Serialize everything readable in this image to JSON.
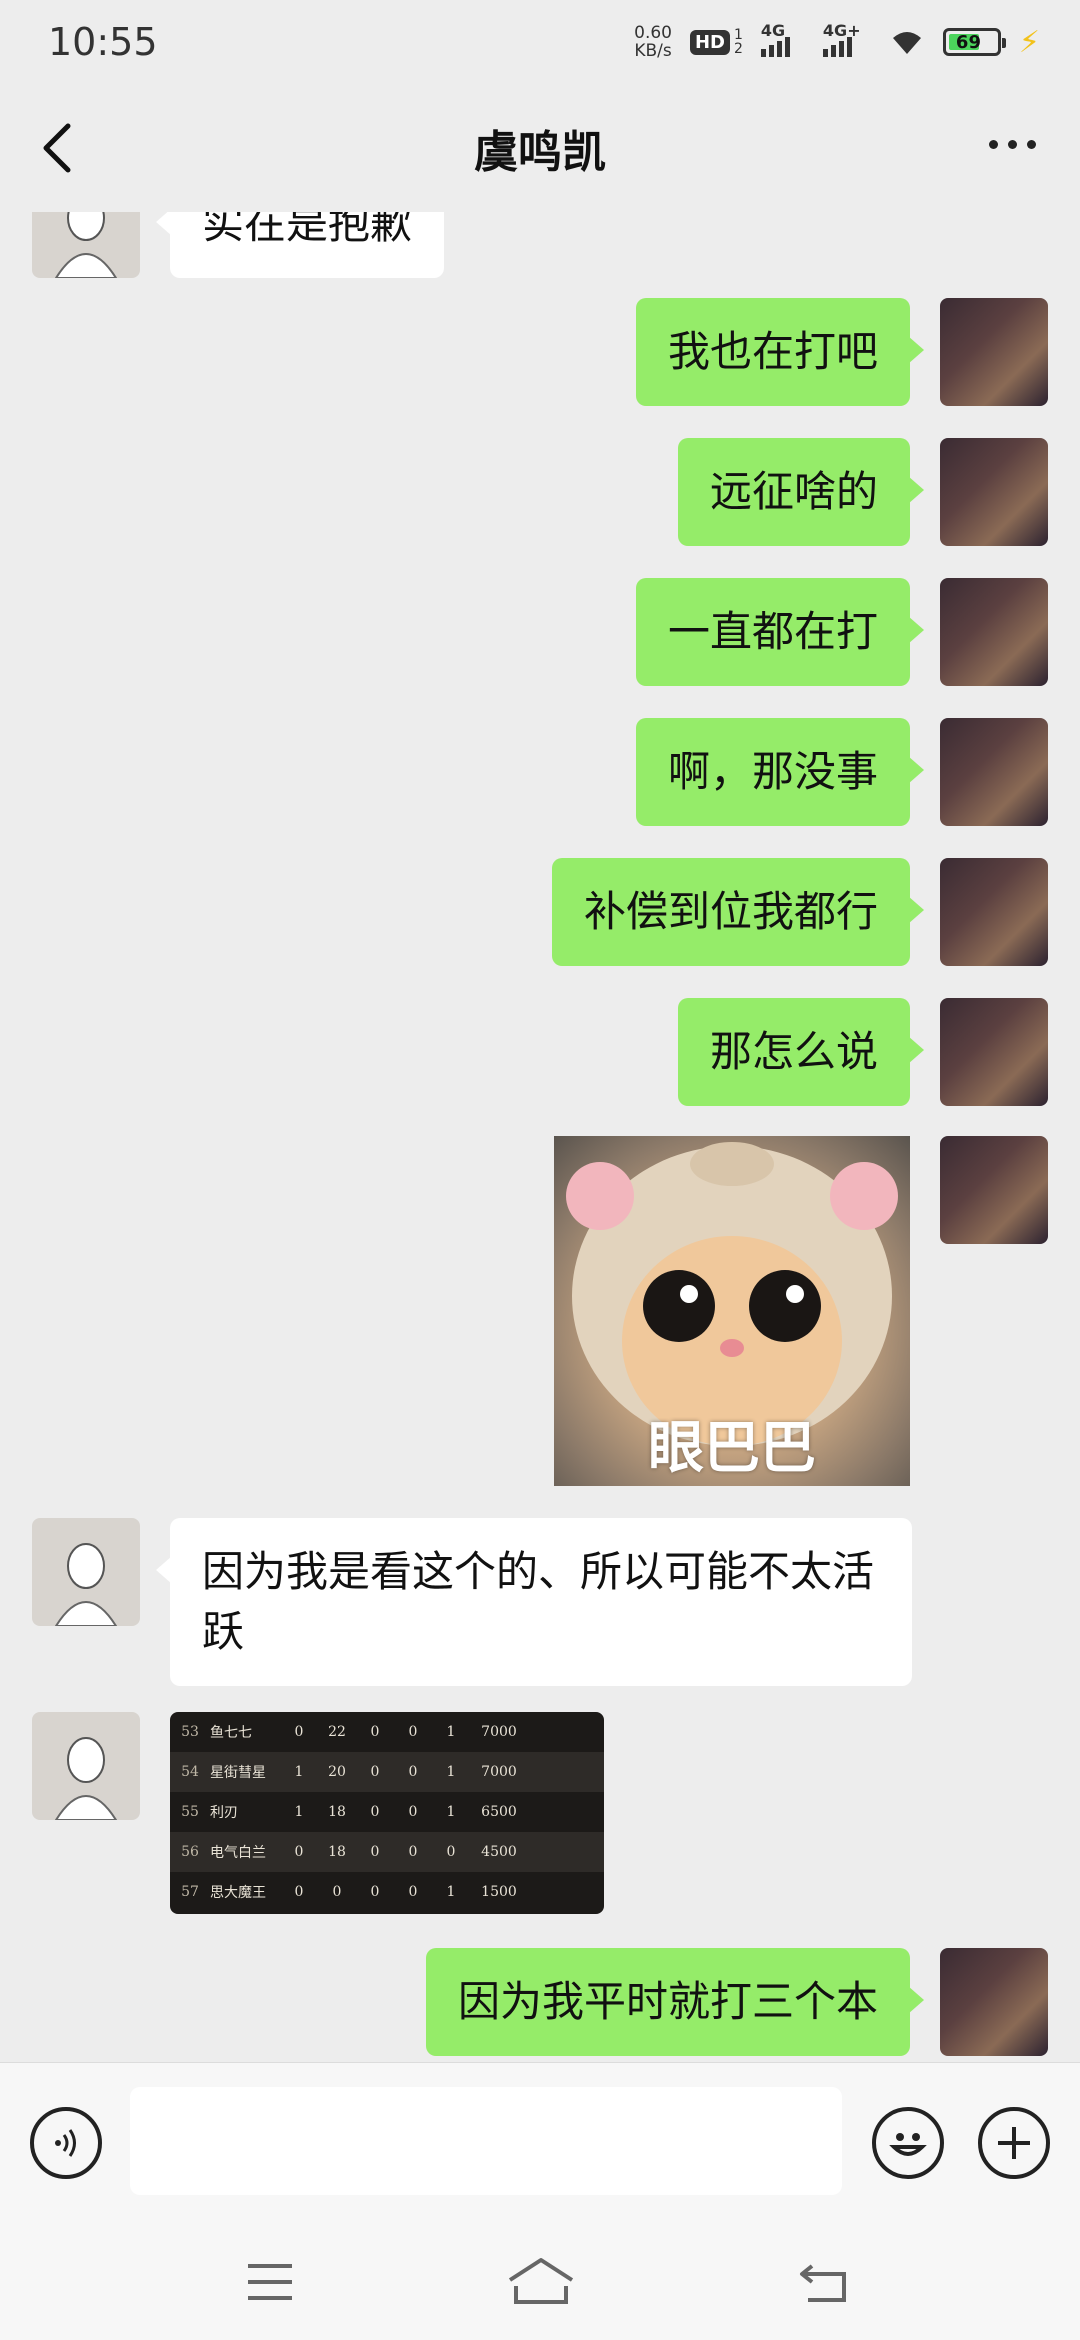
{
  "status_bar": {
    "time": "10:55",
    "net_speed_value": "0.60",
    "net_speed_unit": "KB/s",
    "hd_label": "HD",
    "hd_sub_1": "1",
    "hd_sub_2": "2",
    "signal_1_label": "4G",
    "signal_2_label": "4G+",
    "battery_level": "69",
    "battery_fill_percent": 69
  },
  "header": {
    "title": "虞鸣凯"
  },
  "messages": [
    {
      "side": "in",
      "type": "text",
      "text": "实在是抱歉"
    },
    {
      "side": "out",
      "type": "text",
      "text": "我也在打吧"
    },
    {
      "side": "out",
      "type": "text",
      "text": "远征啥的"
    },
    {
      "side": "out",
      "type": "text",
      "text": "一直都在打"
    },
    {
      "side": "out",
      "type": "text",
      "text": "啊，那没事"
    },
    {
      "side": "out",
      "type": "text",
      "text": "补偿到位我都行"
    },
    {
      "side": "out",
      "type": "text",
      "text": "那怎么说"
    },
    {
      "side": "out",
      "type": "sticker",
      "caption": "眼巴巴"
    },
    {
      "side": "in",
      "type": "text",
      "text": "因为我是看这个的、所以可能不太活跃"
    },
    {
      "side": "in",
      "type": "image"
    },
    {
      "side": "out",
      "type": "text",
      "text": "因为我平时就打三个本"
    }
  ],
  "leaderboard_image": {
    "rows": [
      {
        "rank": "53",
        "name": "鱼七七",
        "c1": "0",
        "c2": "22",
        "c3": "0",
        "c4": "0",
        "c5": "1",
        "score": "7000"
      },
      {
        "rank": "54",
        "name": "星街彗星",
        "c1": "1",
        "c2": "20",
        "c3": "0",
        "c4": "0",
        "c5": "1",
        "score": "7000"
      },
      {
        "rank": "55",
        "name": "利刃",
        "c1": "1",
        "c2": "18",
        "c3": "0",
        "c4": "0",
        "c5": "1",
        "score": "6500"
      },
      {
        "rank": "56",
        "name": "电气白兰",
        "c1": "0",
        "c2": "18",
        "c3": "0",
        "c4": "0",
        "c5": "0",
        "score": "4500"
      },
      {
        "rank": "57",
        "name": "思大魔王",
        "c1": "0",
        "c2": "0",
        "c3": "0",
        "c4": "0",
        "c5": "1",
        "score": "1500"
      }
    ]
  },
  "input_bar": {
    "value": "",
    "voice_icon": "voice-icon",
    "emoji_icon": "emoji-icon",
    "add_icon": "plus-icon"
  },
  "nav_bar": {
    "menu_icon": "menu-icon",
    "home_icon": "home-icon",
    "back_icon": "back-icon"
  },
  "colors": {
    "outgoing_bubble": "#95ec69",
    "incoming_bubble": "#ffffff",
    "background": "#ededed"
  }
}
